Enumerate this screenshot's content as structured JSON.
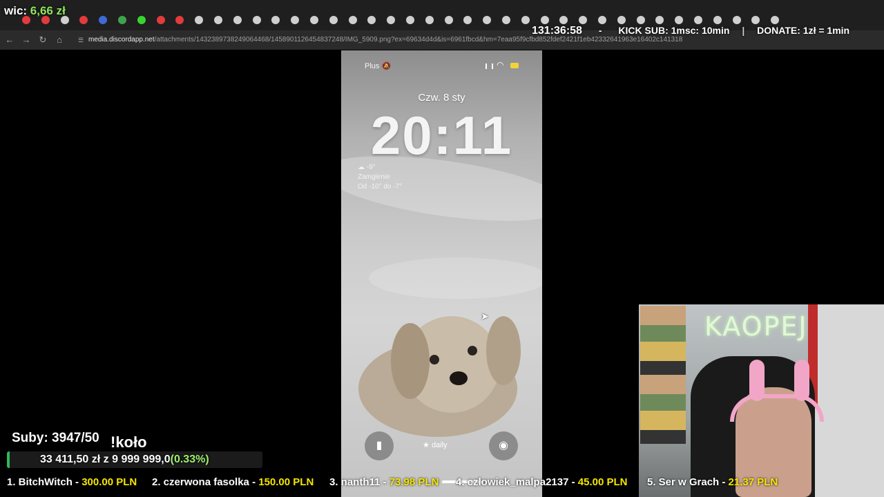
{
  "overlay_top": {
    "donate_label": "wic:",
    "donate_amount": "6,66 zł",
    "clock": "131:36:58",
    "dash": "-",
    "kick_sub": "KICK SUB: 1msc: 10min",
    "bar": "|",
    "donate_rule": "DONATE: 1zł = 1min"
  },
  "browser": {
    "url_host": "media.discordapp.net",
    "url_path": "/attachments/1432389738249064468/1458901126454837248/IMG_5909.png?ex=69634d4d&is=6961fbcd&hm=7eaa95f9cfbd852fdef2421f1eb42332641963e16402c141318cadd95...",
    "tab_icon_colors": [
      "#e23b3b",
      "#e23b3b",
      "#cfcfcf",
      "#e23b3b",
      "#3f6bd7",
      "#3fa34d",
      "#38d430",
      "#e23b3b",
      "#e23b3b",
      "#cfcfcf",
      "#cfcfcf",
      "#cfcfcf",
      "#cfcfcf",
      "#cfcfcf",
      "#cfcfcf",
      "#cfcfcf",
      "#cfcfcf",
      "#cfcfcf",
      "#cfcfcf",
      "#cfcfcf",
      "#cfcfcf",
      "#cfcfcf",
      "#cfcfcf",
      "#cfcfcf",
      "#cfcfcf",
      "#cfcfcf",
      "#cfcfcf",
      "#cfcfcf",
      "#cfcfcf",
      "#cfcfcf",
      "#cfcfcf",
      "#cfcfcf",
      "#cfcfcf",
      "#cfcfcf",
      "#cfcfcf",
      "#cfcfcf",
      "#cfcfcf",
      "#cfcfcf",
      "#cfcfcf",
      "#cfcfcf"
    ]
  },
  "phone": {
    "carrier": "Plus",
    "date": "Czw. 8 sty",
    "time": "20:11",
    "weather_temp": "-9°",
    "weather_desc": "Zamglenie",
    "weather_range": "Od -10° do -7°",
    "focus_label": "daily",
    "icons": [
      "bell-slash-icon",
      "signal-icon",
      "wifi-icon",
      "battery-icon",
      "flashlight-icon",
      "star-icon",
      "camera-icon"
    ]
  },
  "overlay_bottom": {
    "subs": "Suby: 3947/50",
    "wheel": "!koło",
    "goal_current": "33 411,50 zł z",
    "goal_target": "9 999 999,0",
    "goal_percent": "(0.33%)",
    "goal_fraction": 0.0033,
    "accent_green": "#2fb85b",
    "ticker_amount_color": "#f5e600"
  },
  "ticker": [
    {
      "rank_name": "1. BitchWitch - ",
      "amount": "300.00 PLN"
    },
    {
      "rank_name": "2. czerwona fasolka - ",
      "amount": "150.00 PLN"
    },
    {
      "rank_name": "3. nanth11 - ",
      "amount": "73.98 PLN"
    },
    {
      "rank_name": "4. czlowiek_malpa2137 - ",
      "amount": "45.00 PLN"
    },
    {
      "rank_name": "5. Ser w Grach - ",
      "amount": "21.37 PLN"
    }
  ],
  "webcam": {
    "neon_sign": "KAOPEJ"
  }
}
